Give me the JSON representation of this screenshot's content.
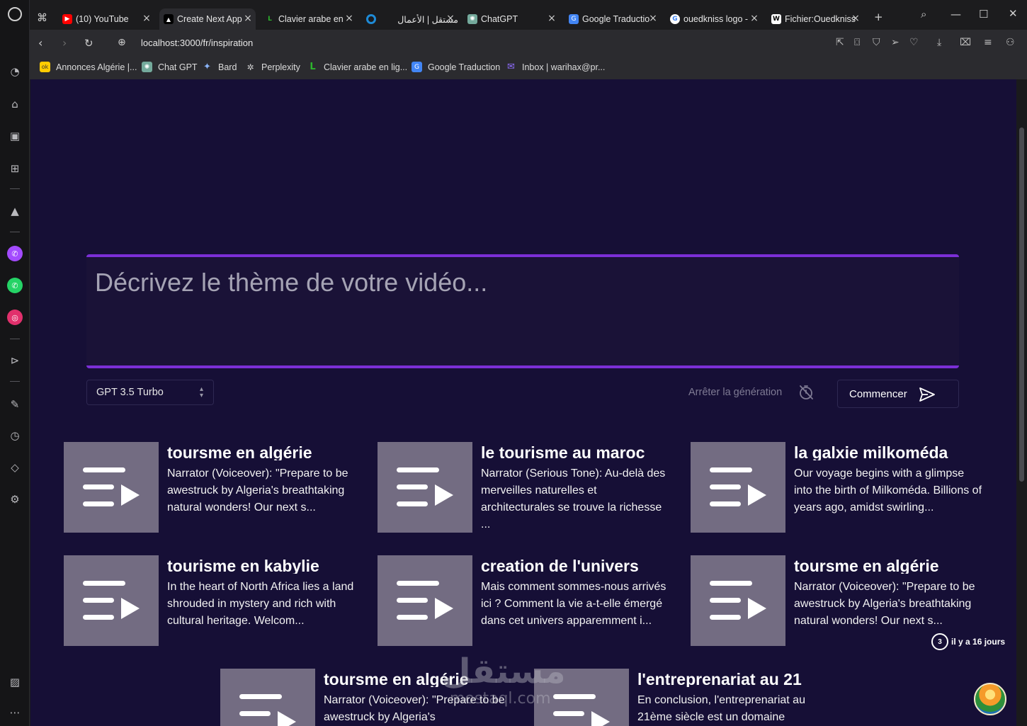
{
  "browser": {
    "tabs": [
      {
        "label": "(10) YouTube",
        "favicon": "youtube-icon",
        "color": "#ff0000",
        "active": false
      },
      {
        "label": "Create Next App",
        "favicon": "nextjs-icon",
        "color": "#000000",
        "active": true
      },
      {
        "label": "Clavier arabe en",
        "favicon": "clavier-icon",
        "color": "#2db52d",
        "active": false
      },
      {
        "label": "مستقل | الأعمال",
        "favicon": "mostaql-icon",
        "color": "#1e8ad6",
        "active": false
      },
      {
        "label": "ChatGPT",
        "favicon": "chatgpt-icon",
        "color": "#74aa9c",
        "active": false
      },
      {
        "label": "Google Traductio",
        "favicon": "google-translate-icon",
        "color": "#4285f4",
        "active": false
      },
      {
        "label": "ouedkniss logo -",
        "favicon": "google-icon",
        "color": "#ffffff",
        "active": false
      },
      {
        "label": "Fichier:Ouedkniss",
        "favicon": "wikipedia-icon",
        "color": "#ffffff",
        "active": false
      }
    ],
    "url": "localhost:3000/fr/inspiration",
    "bookmarks": [
      {
        "label": "Annonces Algérie |...",
        "favicon": "ouedkniss-icon",
        "color": "#ffcc00"
      },
      {
        "label": "Chat GPT",
        "favicon": "chatgpt-icon",
        "color": "#74aa9c"
      },
      {
        "label": "Bard",
        "favicon": "bard-icon",
        "color": "#8ab4f8"
      },
      {
        "label": "Perplexity",
        "favicon": "perplexity-icon",
        "color": "#cfcfcf"
      },
      {
        "label": "Clavier arabe en lig...",
        "favicon": "clavier-icon",
        "color": "#2db52d"
      },
      {
        "label": "Google Traduction",
        "favicon": "google-translate-icon",
        "color": "#4285f4"
      },
      {
        "label": "Inbox | warihax@pr...",
        "favicon": "proton-mail-icon",
        "color": "#6d4aff"
      }
    ]
  },
  "page": {
    "prompt_placeholder": "Décrivez le thème de votre vidéo...",
    "model": "GPT 3.5 Turbo",
    "stop_label": "Arrêter la génération",
    "start_label": "Commencer",
    "accent": "#7b2fd6",
    "background": "#160f36",
    "cards": [
      {
        "title": "toursme en algérie",
        "desc": "Narrator (Voiceover): \"Prepare to be awestruck by Algeria's breathtaking natural wonders! Our next s..."
      },
      {
        "title": "le tourisme au maroc",
        "desc": "Narrator (Serious Tone): Au-delà des merveilles naturelles et architecturales se trouve la richesse ..."
      },
      {
        "title": "la galxie milkoméda",
        "desc": "Our voyage begins with a glimpse into the birth of Milkoméda. Billions of years ago, amidst swirling..."
      },
      {
        "title": "tourisme en kabylie",
        "desc": "In the heart of North Africa lies a land shrouded in mystery and rich with cultural heritage. Welcom..."
      },
      {
        "title": "creation de l'univers",
        "desc": "Mais comment sommes-nous arrivés ici ? Comment la vie a-t-elle émergé dans cet univers apparemment i..."
      },
      {
        "title": "toursme en algérie",
        "desc": "Narrator (Voiceover): \"Prepare to be awestruck by Algeria's breathtaking natural wonders! Our next s..."
      },
      {
        "title": "toursme en algérie",
        "desc": "Narrator (Voiceover): \"Prepare to be awestruck by Algeria's"
      },
      {
        "title": "l'entreprenariat au 21",
        "desc": "En conclusion, l'entreprenariat au 21ème siècle est un domaine"
      }
    ],
    "watermark": "مستقل",
    "watermark_sub": "mostaql.com",
    "badge_text": "il y a 16 jours",
    "badge_number": "3"
  }
}
